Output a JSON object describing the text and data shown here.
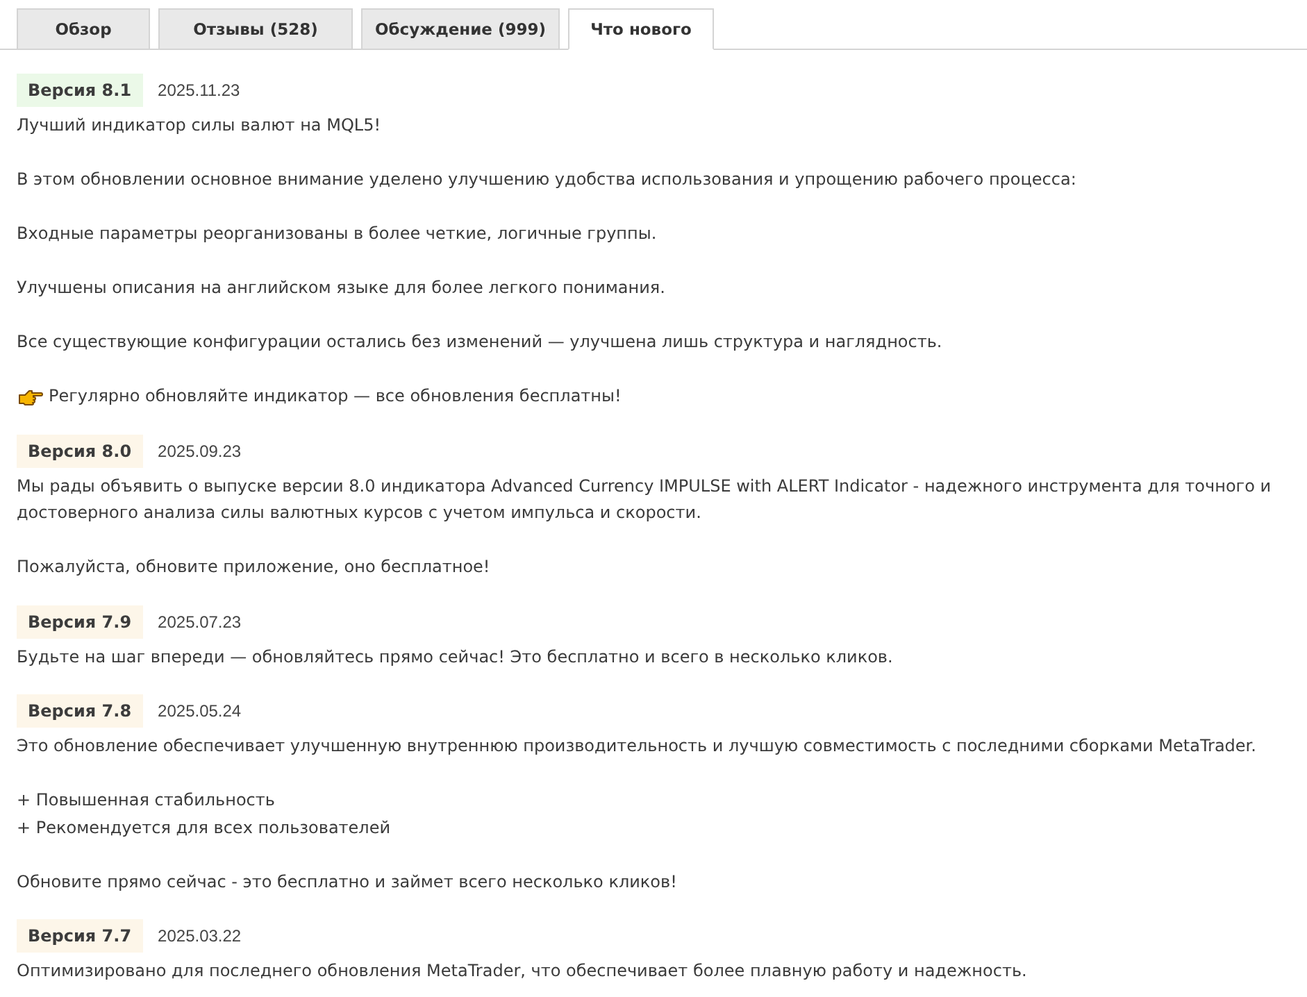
{
  "tabs": [
    {
      "label": "Обзор",
      "selected": false
    },
    {
      "label": "Отзывы (528)",
      "selected": false
    },
    {
      "label": "Обсуждение (999)",
      "selected": false
    },
    {
      "label": "Что нового",
      "selected": true
    }
  ],
  "versions": [
    {
      "label": "Версия 8.1",
      "date": "2025.11.23",
      "color": "#ebf9e8",
      "blocks": [
        {
          "kind": "text",
          "text": "Лучший индикатор силы валют на MQL5!"
        },
        {
          "kind": "text",
          "text": "В этом обновлении основное внимание уделено улучшению удобства использования и упрощению рабочего процесса:"
        },
        {
          "kind": "text",
          "text": "Входные параметры реорганизованы в более четкие, логичные группы."
        },
        {
          "kind": "text",
          "text": "Улучшены описания на английском языке для более легкого понимания."
        },
        {
          "kind": "text",
          "text": "Все существующие конфигурации остались без изменений — улучшена лишь структура и наглядность."
        },
        {
          "kind": "pointer",
          "text": "Регулярно обновляйте индикатор — все обновления бесплатны!"
        }
      ]
    },
    {
      "label": "Версия 8.0",
      "date": "2025.09.23",
      "color": "#fdf6e9",
      "blocks": [
        {
          "kind": "text",
          "text": "Мы рады объявить о выпуске версии 8.0 индикатора Advanced Currency IMPULSE with ALERT Indicator - надежного инструмента для точного и достоверного анализа силы валютных курсов с учетом импульса и скорости."
        },
        {
          "kind": "text",
          "text": "Пожалуйста, обновите приложение, оно бесплатное!"
        }
      ]
    },
    {
      "label": "Версия 7.9",
      "date": "2025.07.23",
      "color": "#fdf6e9",
      "blocks": [
        {
          "kind": "text",
          "text": "Будьте на шаг впереди — обновляйтесь прямо сейчас! Это бесплатно и всего в несколько кликов."
        }
      ]
    },
    {
      "label": "Версия 7.8",
      "date": "2025.05.24",
      "color": "#fdf6e9",
      "blocks": [
        {
          "kind": "text",
          "text": "Это обновление обеспечивает улучшенную внутреннюю производительность и лучшую совместимость с последними сборками MetaTrader."
        },
        {
          "kind": "list",
          "items": [
            "+ Повышенная стабильность",
            "+ Рекомендуется для всех пользователей"
          ]
        },
        {
          "kind": "text",
          "text": "Обновите прямо сейчас - это бесплатно и займет всего несколько кликов!"
        }
      ]
    },
    {
      "label": "Версия 7.7",
      "date": "2025.03.22",
      "color": "#fdf6e9",
      "blocks": [
        {
          "kind": "text",
          "text": "Оптимизировано для последнего обновления MetaTrader, что обеспечивает более плавную работу и надежность."
        }
      ]
    }
  ]
}
